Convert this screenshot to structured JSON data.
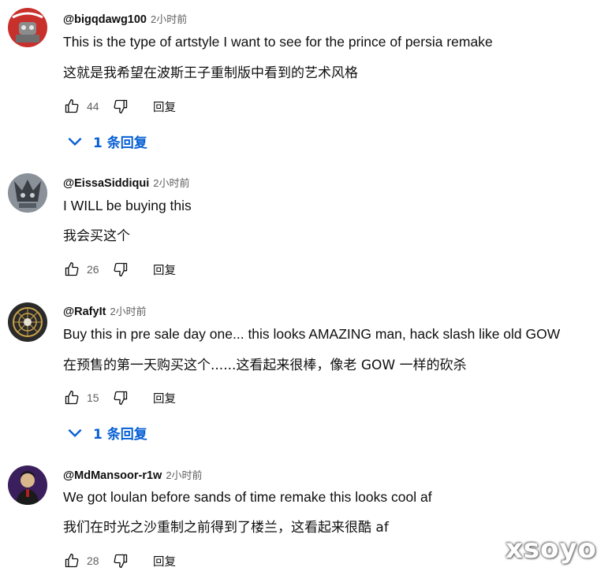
{
  "comments": [
    {
      "author": "@bigqdawg100",
      "time": "2小时前",
      "text_en": "This is the type of artstyle I want to see for the prince of persia remake",
      "text_zh": "这就是我希望在波斯王子重制版中看到的艺术风格",
      "likes": "44",
      "reply_label": "回复",
      "replies_label": "1 条回复",
      "avatar_colors": [
        "#c8302c",
        "#ffffff"
      ]
    },
    {
      "author": "@EissaSiddiqui",
      "time": "2小时前",
      "text_en": "I WILL be buying this",
      "text_zh": "我会买这个",
      "likes": "26",
      "reply_label": "回复",
      "avatar_colors": [
        "#8a9198",
        "#3a3f45"
      ]
    },
    {
      "author": "@RafyIt",
      "time": "2小时前",
      "text_en": "Buy this in pre sale day one... this looks AMAZING man, hack slash like old GOW",
      "text_zh": "在预售的第一天购买这个......这看起来很棒，像老 GOW 一样的砍杀",
      "likes": "15",
      "reply_label": "回复",
      "replies_label": "1 条回复",
      "avatar_colors": [
        "#2a2a2a",
        "#c9a24a"
      ]
    },
    {
      "author": "@MdMansoor-r1w",
      "time": "2小时前",
      "text_en": "We got loulan before sands of time remake this looks cool af",
      "text_zh": "我们在时光之沙重制之前得到了楼兰，这看起来很酷 af",
      "likes": "28",
      "reply_label": "回复",
      "avatar_colors": [
        "#3a1f5c",
        "#d9b98c"
      ]
    }
  ],
  "watermark": "xsoyo",
  "icons": {
    "like": "thumbs-up-icon",
    "dislike": "thumbs-down-icon",
    "replies": "chevron-down-icon"
  },
  "colors": {
    "link_blue": "#065fd4",
    "secondary_text": "#606060"
  }
}
